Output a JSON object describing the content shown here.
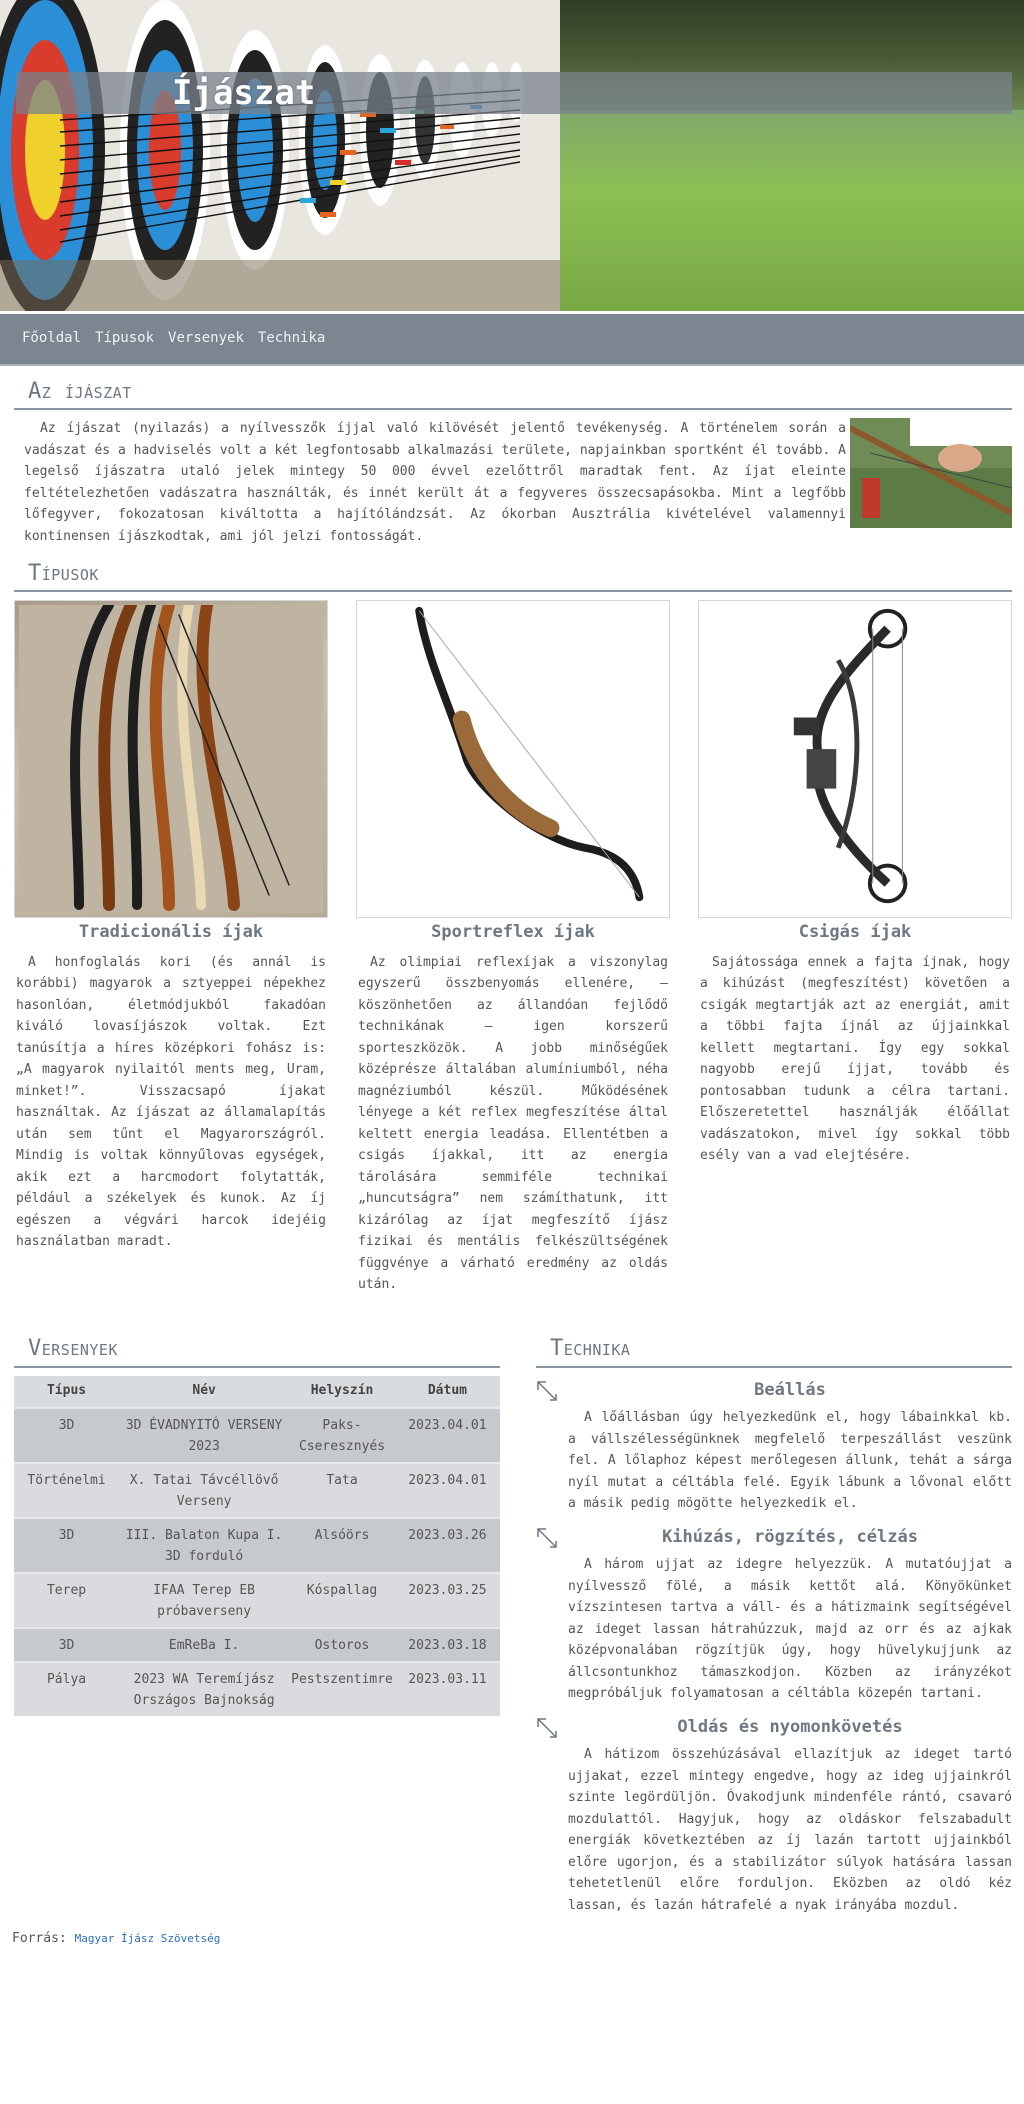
{
  "hero": {
    "title": "Íjászat"
  },
  "nav": {
    "items": [
      "Főoldal",
      "Típusok",
      "Versenyek",
      "Technika"
    ]
  },
  "about": {
    "heading": "Az íjászat",
    "text": "Az íjászat (nyilazás) a nyílvesszők íjjal való kilövését jelentő tevékenység. A történelem során a vadászat és a hadviselés volt a két legfontosabb alkalmazási területe, napjainkban sportként él tovább. A legelső íjászatra utaló jelek mintegy 50 000 évvel ezelőttről maradtak fent. Az íjat eleinte feltételezhetően vadászatra használták, és innét került át a fegyveres összecsapásokba. Mint a legfőbb lőfegyver, fokozatosan kiváltotta a hajítólándzsát. Az ókorban Ausztrália kivételével valamennyi kontinensen íjászkodtak, ami jól jelzi fontosságát."
  },
  "types": {
    "heading": "Típusok",
    "cards": [
      {
        "title": "Tradicionális íjak",
        "text": "A honfoglalás kori (és annál is korábbi) magyarok a sztyeppei népekhez hasonlóan, életmódjukból fakadóan kiváló lovasíjászok voltak. Ezt tanúsítja a híres középkori fohász is: „A magyarok nyilaitól ments meg, Uram, minket!”. Visszacsapó íjakat használtak. Az íjászat az államalapítás után sem tűnt el Magyarországról. Mindig is voltak könnyűlovas egységek, akik ezt a harcmodort folytatták, például a székelyek és kunok. Az íj egészen a végvári harcok idejéig használatban maradt."
      },
      {
        "title": "Sportreflex íjak",
        "text": "Az olimpiai reflexíjak a viszonylag egyszerű összbenyomás ellenére, – köszönhetően az állandóan fejlődő technikának – igen korszerű sporteszközök. A jobb minőségűek középrésze általában alumíniumból, néha magnéziumból készül. Működésének lényege a két reflex megfeszítése által keltett energia leadása. Ellentétben a csigás íjakkal, itt az energia tárolására semmiféle technikai „huncutságra” nem számíthatunk, itt kizárólag az íjat megfeszítő íjász fizikai és mentális felkészültségének függvénye a várható eredmény az oldás után."
      },
      {
        "title": "Csigás íjak",
        "text": "Sajátossága ennek a fajta íjnak, hogy a kihúzást (megfeszítést) követően a csigák megtartják azt az energiát, amit a többi fajta íjnál az újjainkkal kellett megtartani. Így egy sokkal nagyobb erejű íjjat, tovább és pontosabban tudunk a célra tartani. Előszeretettel használják élőállat vadászatokon, mivel így sokkal több esély van a vad elejtésére."
      }
    ]
  },
  "competitions": {
    "heading": "Versenyek",
    "columns": [
      "Típus",
      "Név",
      "Helyszín",
      "Dátum"
    ],
    "rows": [
      [
        "3D",
        "3D ÉVADNYITÓ VERSENY 2023",
        "Paks-Cseresznyés",
        "2023.04.01"
      ],
      [
        "Történelmi",
        "X. Tatai Távcéllövő Verseny",
        "Tata",
        "2023.04.01"
      ],
      [
        "3D",
        "III. Balaton Kupa I. 3D forduló",
        "Alsóörs",
        "2023.03.26"
      ],
      [
        "Terep",
        "IFAA Terep EB próbaverseny",
        "Kóspallag",
        "2023.03.25"
      ],
      [
        "3D",
        "EmReBa I.",
        "Ostoros",
        "2023.03.18"
      ],
      [
        "Pálya",
        "2023 WA Teremíjász Országos Bajnokság",
        "Pestszentimre",
        "2023.03.11"
      ]
    ]
  },
  "technique": {
    "heading": "Technika",
    "items": [
      {
        "title": "Beállás",
        "text": "A lőállásban úgy helyezkedünk el, hogy lábainkkal kb. a vállszélességünknek megfelelő terpeszállást veszünk fel. A lőlaphoz képest merőlegesen állunk, tehát a sárga nyíl mutat a céltábla felé. Egyik lábunk a lővonal előtt a másik pedig mögötte helyezkedik el."
      },
      {
        "title": "Kihúzás, rögzítés, célzás",
        "text": "A három ujjat az idegre helyezzük. A mutatóujjat a nyílvessző fölé, a másik kettőt alá. Könyökünket vízszintesen tartva a váll- és a hátizmaink segítségével az ideget lassan hátrahúzzuk, majd az orr és az ajkak középvonalában rögzítjük úgy, hogy hüvelykujjunk az állcsontunkhoz támaszkodjon. Közben az irányzékot megpróbáljuk folyamatosan a céltábla közepén tartani."
      },
      {
        "title": "Oldás és nyomonkövetés",
        "text": "A hátizom összehúzásával ellazítjuk az ideget tartó ujjakat, ezzel mintegy engedve, hogy az ideg ujjainkról szinte legördüljön. Óvakodjunk mindenféle rántó, csavaró mozdulattól. Hagyjuk, hogy az oldáskor felszabadult energiák következtében az íj lazán tartott ujjainkból előre ugorjon, és a stabilizátor súlyok hatására lassan tehetetlenül előre forduljon. Eközben az oldó kéz lassan, és lazán hátrafelé a nyak irányába mozdul."
      }
    ]
  },
  "footer": {
    "label": "Forrás:",
    "link": "Magyar Íjász Szövetség"
  }
}
